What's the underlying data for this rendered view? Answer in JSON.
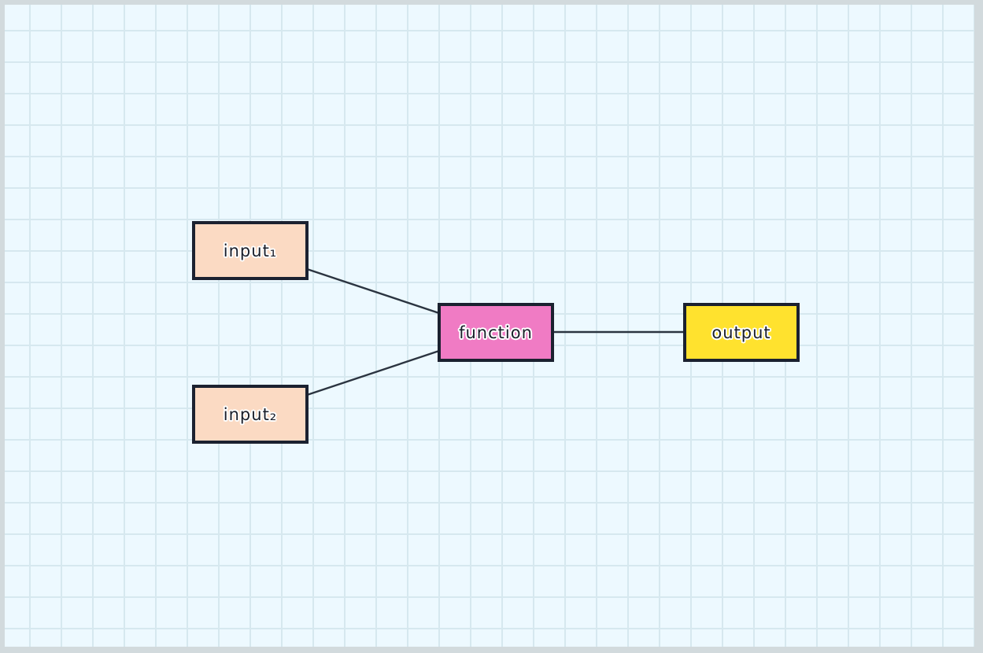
{
  "diagram": {
    "nodes": [
      {
        "id": "input1",
        "label": "input₁",
        "color": "#fbdac3"
      },
      {
        "id": "input2",
        "label": "input₂",
        "color": "#fbdac3"
      },
      {
        "id": "function",
        "label": "function",
        "color": "#f07bc4"
      },
      {
        "id": "output",
        "label": "output",
        "color": "#ffe22e"
      }
    ],
    "edges": [
      {
        "from": "input1",
        "to": "function"
      },
      {
        "from": "input2",
        "to": "function"
      },
      {
        "from": "function",
        "to": "output"
      }
    ],
    "border_color": "#1b2130",
    "edge_color": "#2b3440",
    "background_color": "#edf9ff",
    "grid": true
  }
}
